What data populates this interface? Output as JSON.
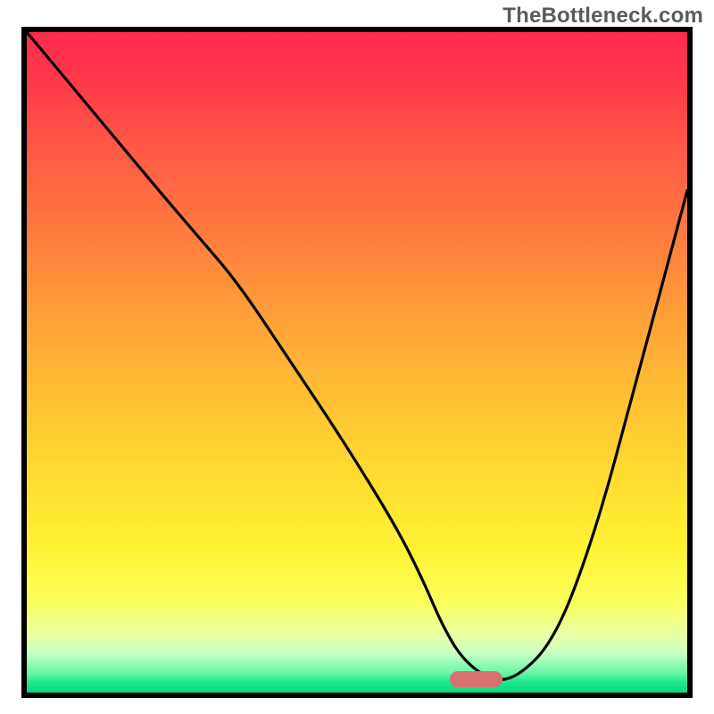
{
  "watermark": "TheBottleneck.com",
  "chart_data": {
    "type": "line",
    "title": "",
    "xlabel": "",
    "ylabel": "",
    "xlim": [
      0,
      100
    ],
    "ylim": [
      0,
      100
    ],
    "grid": false,
    "legend": false,
    "background_gradient": {
      "direction": "vertical",
      "stops": [
        {
          "pos": 0,
          "color": "#ff2a4d"
        },
        {
          "pos": 50,
          "color": "#ffc233"
        },
        {
          "pos": 80,
          "color": "#fcff4a"
        },
        {
          "pos": 100,
          "color": "#06d97e"
        }
      ]
    },
    "series": [
      {
        "name": "bottleneck-curve",
        "x": [
          0,
          10,
          20,
          26,
          32,
          40,
          48,
          56,
          60,
          63,
          66,
          70,
          74,
          80,
          86,
          92,
          100
        ],
        "y": [
          100,
          88,
          76,
          69,
          62,
          50,
          38,
          25,
          17,
          10,
          5,
          2,
          2,
          8,
          24,
          46,
          76
        ]
      }
    ],
    "marker": {
      "name": "optimal-range",
      "x_start": 64,
      "x_end": 72,
      "y": 2,
      "color": "#d87070"
    }
  }
}
